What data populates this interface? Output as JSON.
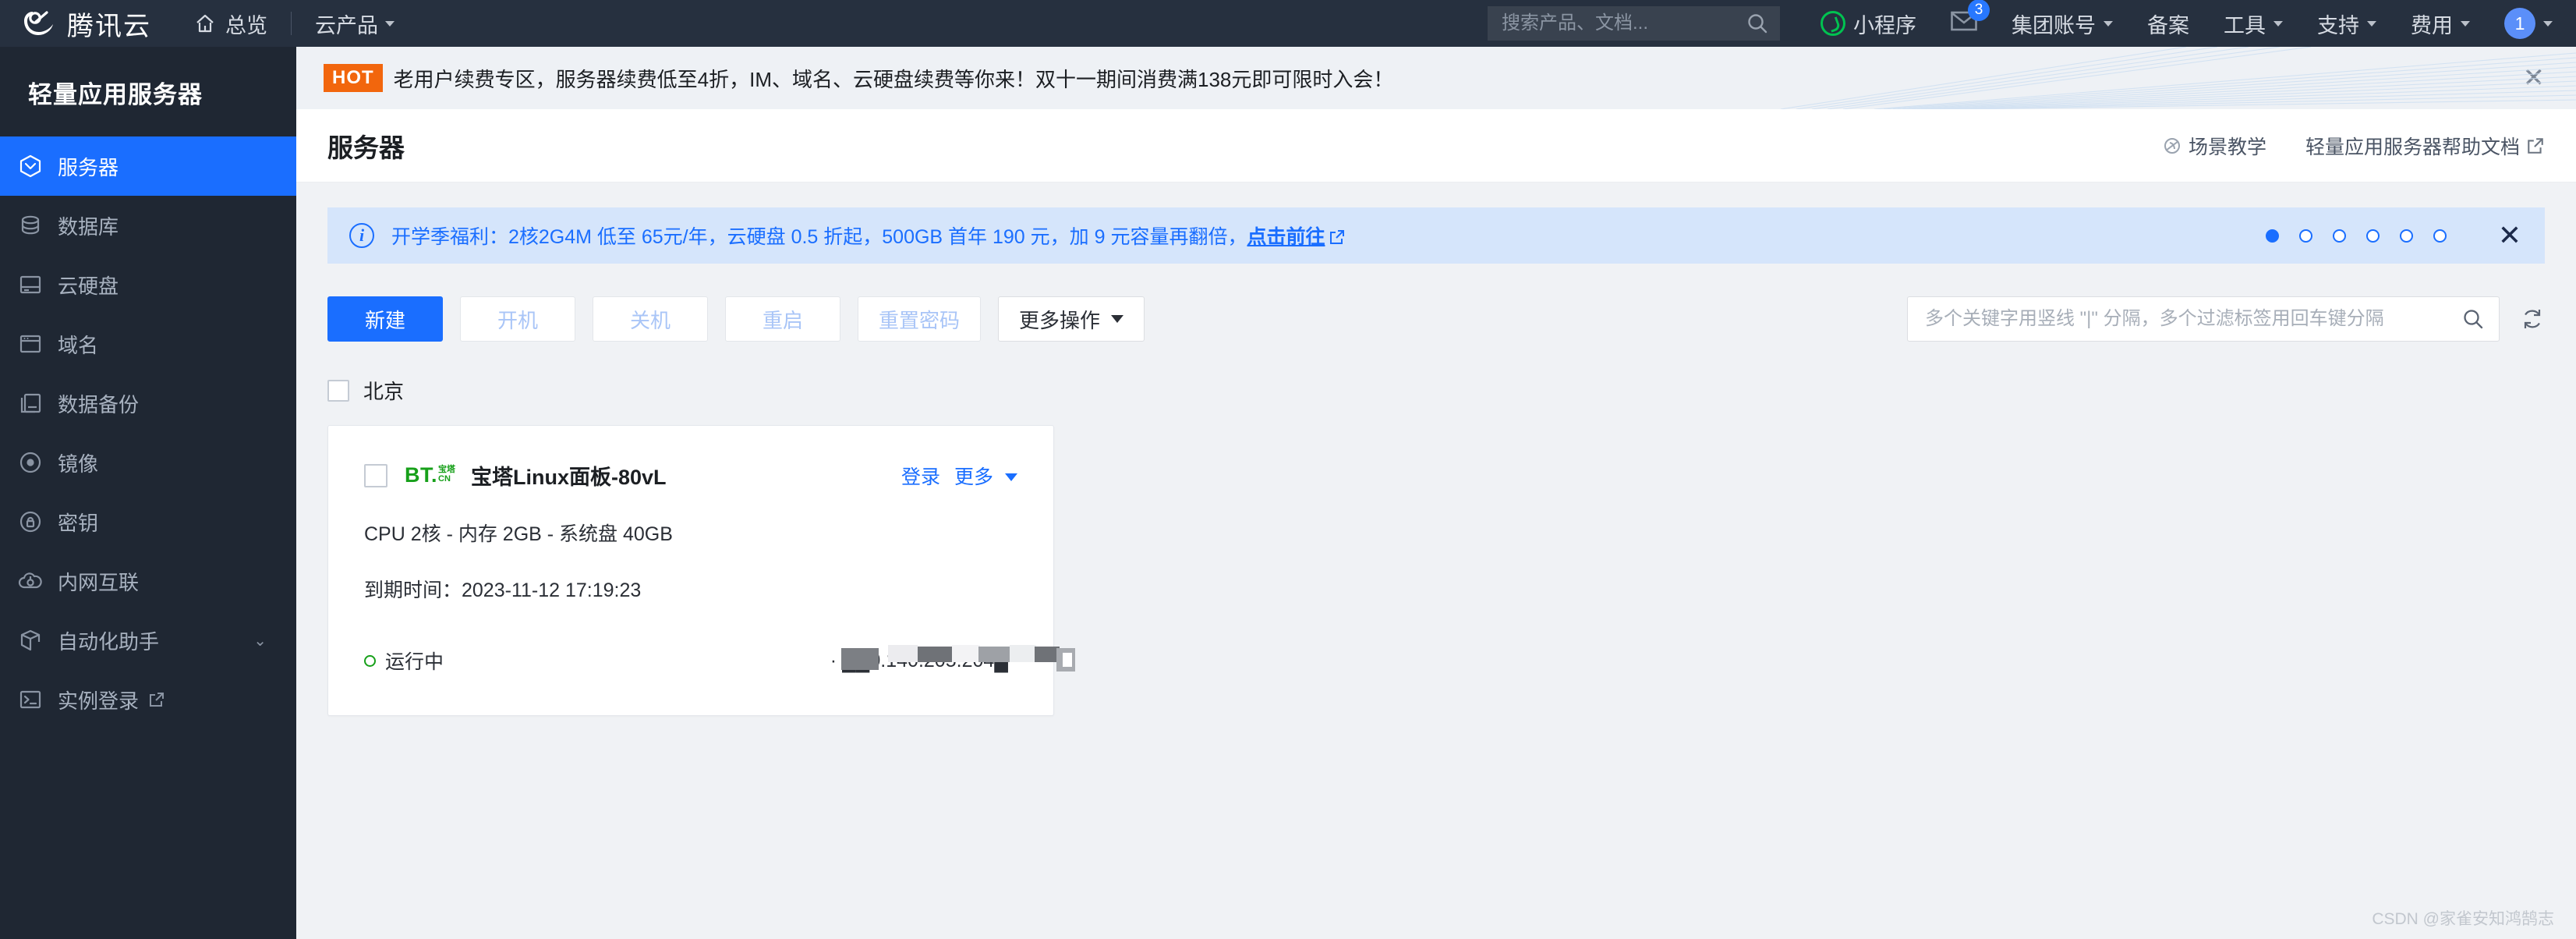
{
  "topnav": {
    "brand": "腾讯云",
    "home": "总览",
    "products": "云产品",
    "search_placeholder": "搜索产品、文档...",
    "search_value": "",
    "items": [
      {
        "label": "小程序",
        "icon": "wechat-miniprogram-icon"
      },
      {
        "label": "",
        "icon": "mail-icon",
        "badge": "3"
      },
      {
        "label": "集团账号",
        "caret": true
      },
      {
        "label": "备案",
        "caret": false
      },
      {
        "label": "工具",
        "caret": true
      },
      {
        "label": "支持",
        "caret": true
      },
      {
        "label": "费用",
        "caret": true
      }
    ],
    "avatar_text": "1"
  },
  "sidebar": {
    "title": "轻量应用服务器",
    "items": [
      {
        "label": "服务器",
        "icon": "server-icon",
        "active": true
      },
      {
        "label": "数据库",
        "icon": "database-icon",
        "active": false
      },
      {
        "label": "云硬盘",
        "icon": "disk-icon",
        "active": false
      },
      {
        "label": "域名",
        "icon": "domain-icon",
        "active": false
      },
      {
        "label": "数据备份",
        "icon": "backup-icon",
        "active": false
      },
      {
        "label": "镜像",
        "icon": "image-icon",
        "active": false
      },
      {
        "label": "密钥",
        "icon": "key-icon",
        "active": false
      },
      {
        "label": "内网互联",
        "icon": "network-icon",
        "active": false
      },
      {
        "label": "自动化助手",
        "icon": "automation-icon",
        "active": false,
        "chevron": true
      },
      {
        "label": "实例登录",
        "icon": "terminal-icon",
        "active": false,
        "external": true
      }
    ]
  },
  "hot_banner": {
    "tag": "HOT",
    "text": "老用户续费专区，服务器续费低至4折，IM、域名、云硬盘续费等你来！双十一期间消费满138元即可限时入会！",
    "close": "✕"
  },
  "page": {
    "title": "服务器",
    "links": [
      {
        "label": "场景教学",
        "icon": "play-tutorial-icon"
      },
      {
        "label": "轻量应用服务器帮助文档",
        "icon": "external-link-icon"
      }
    ]
  },
  "info_banner": {
    "icon": "info-icon",
    "text_before": "开学季福利：2核2G4M 低至 65元/年，云硬盘 0.5 折起，500GB 首年 190 元，加 9 元容量再翻倍，",
    "link": "点击前往",
    "dots_total": 6,
    "dots_active": 1,
    "close": "✕",
    "accent": "#1a6eff",
    "background": "#d5e5fb"
  },
  "toolbar": {
    "create": "新建",
    "power_on": "开机",
    "power_off": "关机",
    "restart": "重启",
    "reset_password": "重置密码",
    "more_actions": "更多操作",
    "search_placeholder": "多个关键字用竖线 \"|\" 分隔，多个过滤标签用回车键分隔",
    "search_value": "",
    "search_icon": "search-icon",
    "refresh_icon": "refresh-icon"
  },
  "region": {
    "label": "北京",
    "checked": false
  },
  "server_card": {
    "checked": false,
    "logo_main": "BT.",
    "logo_sub_top": "宝塔",
    "logo_sub_bottom": "CN",
    "name": "宝塔Linux面板-80vL",
    "login_link": "登录",
    "more_link": "更多",
    "spec": "CPU 2核 - 内存 2GB - 系统盘 40GB",
    "expire": "到期时间：2023-11-12 17:19:23",
    "status": "运行中",
    "status_color": "#17a01a",
    "ip": "· ██0.140.205.204█"
  },
  "watermark": "CSDN @家雀安知鸿鹄志"
}
